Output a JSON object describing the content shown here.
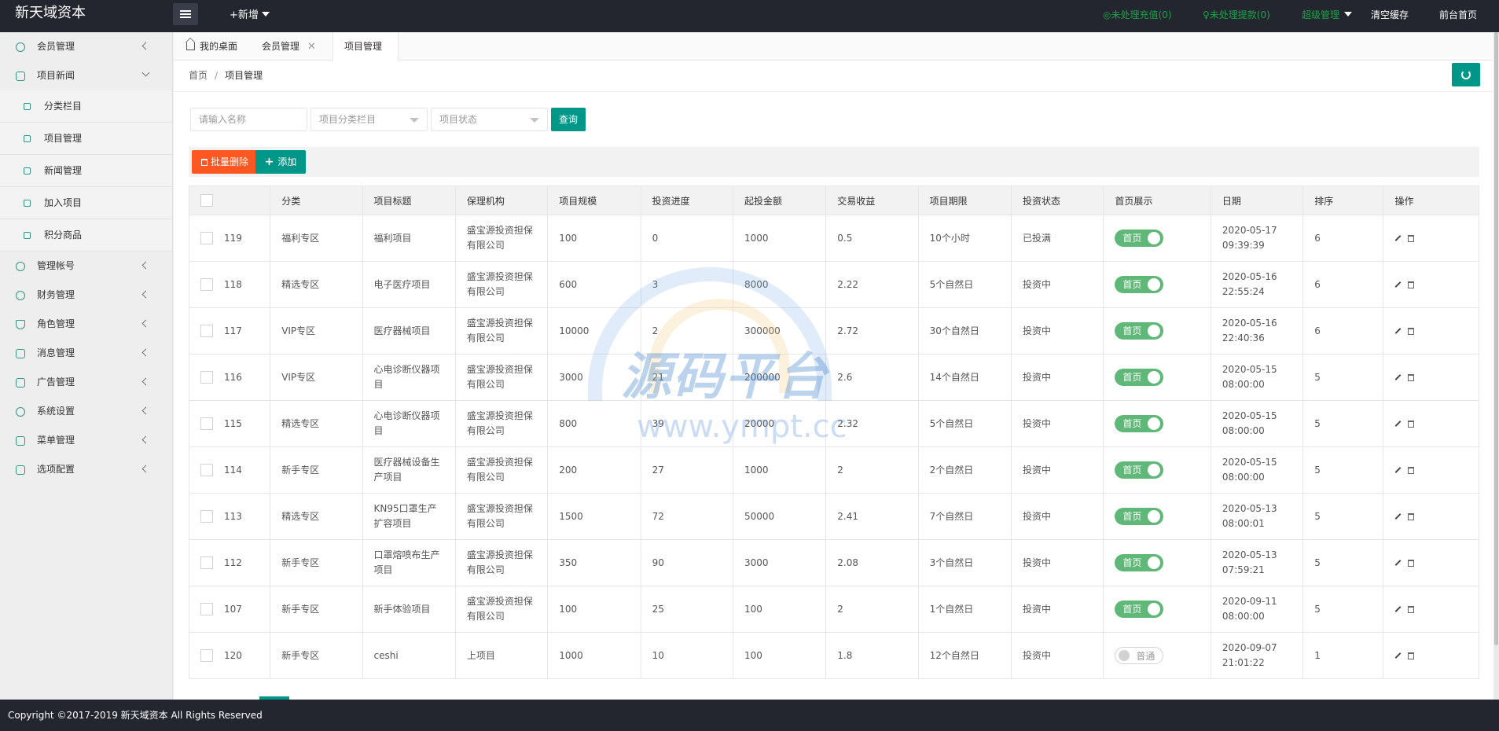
{
  "app": {
    "logo": "新天域资本"
  },
  "topbar": {
    "new_label": "+新增",
    "pending_recharge": "未处理充值(0)",
    "pending_withdraw": "未处理提款(0)",
    "admin_menu": "超级管理",
    "clear_cache": "清空缓存",
    "front_home": "前台首页"
  },
  "sidebar": {
    "items": [
      {
        "label": "会员管理",
        "icon": "user-icon",
        "expanded": false
      },
      {
        "label": "项目新闻",
        "icon": "book-icon",
        "expanded": true
      },
      {
        "label": "管理帐号",
        "icon": "users-icon",
        "expanded": false
      },
      {
        "label": "财务管理",
        "icon": "yen-icon",
        "expanded": false
      },
      {
        "label": "角色管理",
        "icon": "shield-icon",
        "expanded": false
      },
      {
        "label": "消息管理",
        "icon": "speaker-icon",
        "expanded": false
      },
      {
        "label": "广告管理",
        "icon": "image-icon",
        "expanded": false
      },
      {
        "label": "系统设置",
        "icon": "gear-icon",
        "expanded": false
      },
      {
        "label": "菜单管理",
        "icon": "grid-icon",
        "expanded": false
      },
      {
        "label": "选项配置",
        "icon": "tools-icon",
        "expanded": false
      }
    ],
    "subitems": [
      {
        "label": "分类栏目",
        "icon": "leaf-icon"
      },
      {
        "label": "项目管理",
        "icon": "cart-icon"
      },
      {
        "label": "新闻管理",
        "icon": "doc-icon"
      },
      {
        "label": "加入项目",
        "icon": "cart-icon"
      },
      {
        "label": "积分商品",
        "icon": "gift-icon"
      }
    ]
  },
  "tabs": [
    {
      "label": "我的桌面",
      "icon": "home-icon",
      "closable": false
    },
    {
      "label": "会员管理",
      "closable": true
    },
    {
      "label": "项目管理",
      "closable": true,
      "active": true
    }
  ],
  "breadcrumb": {
    "home": "首页",
    "sep": "/",
    "current": "项目管理"
  },
  "search": {
    "name_placeholder": "请输入名称",
    "category_select": "项目分类栏目",
    "status_select": "项目状态",
    "query_label": "查询"
  },
  "toolbar": {
    "batch_delete": "批量删除",
    "add": "添加"
  },
  "table": {
    "headers": [
      "分类",
      "项目标题",
      "保理机构",
      "项目规模",
      "投资进度",
      "起投金额",
      "交易收益",
      "项目期限",
      "投资状态",
      "首页展示",
      "日期",
      "排序",
      "操作"
    ],
    "rows": [
      {
        "id": "119",
        "category": "福利专区",
        "title": "福利项目",
        "agency": "盛宝源投资担保有限公司",
        "scale": "100",
        "progress": "0",
        "min_invest": "1000",
        "yield": "0.5",
        "term": "10个小时",
        "status": "已投满",
        "home": "首页",
        "home_on": true,
        "date": "2020-05-17 09:39:39",
        "sort": "6"
      },
      {
        "id": "118",
        "category": "精选专区",
        "title": "电子医疗项目",
        "agency": "盛宝源投资担保有限公司",
        "scale": "600",
        "progress": "3",
        "min_invest": "8000",
        "yield": "2.22",
        "term": "5个自然日",
        "status": "投资中",
        "home": "首页",
        "home_on": true,
        "date": "2020-05-16 22:55:24",
        "sort": "6"
      },
      {
        "id": "117",
        "category": "VIP专区",
        "title": "医疗器械项目",
        "agency": "盛宝源投资担保有限公司",
        "scale": "10000",
        "progress": "2",
        "min_invest": "300000",
        "yield": "2.72",
        "term": "30个自然日",
        "status": "投资中",
        "home": "首页",
        "home_on": true,
        "date": "2020-05-16 22:40:36",
        "sort": "6"
      },
      {
        "id": "116",
        "category": "VIP专区",
        "title": "心电诊断仪器项目",
        "agency": "盛宝源投资担保有限公司",
        "scale": "3000",
        "progress": "21",
        "min_invest": "200000",
        "yield": "2.6",
        "term": "14个自然日",
        "status": "投资中",
        "home": "首页",
        "home_on": true,
        "date": "2020-05-15 08:00:00",
        "sort": "5"
      },
      {
        "id": "115",
        "category": "精选专区",
        "title": "心电诊断仪器项目",
        "agency": "盛宝源投资担保有限公司",
        "scale": "800",
        "progress": "39",
        "min_invest": "20000",
        "yield": "2.32",
        "term": "5个自然日",
        "status": "投资中",
        "home": "首页",
        "home_on": true,
        "date": "2020-05-15 08:00:00",
        "sort": "5"
      },
      {
        "id": "114",
        "category": "新手专区",
        "title": "医疗器械设备生产项目",
        "agency": "盛宝源投资担保有限公司",
        "scale": "200",
        "progress": "27",
        "min_invest": "1000",
        "yield": "2",
        "term": "2个自然日",
        "status": "投资中",
        "home": "首页",
        "home_on": true,
        "date": "2020-05-15 08:00:00",
        "sort": "5"
      },
      {
        "id": "113",
        "category": "精选专区",
        "title": "KN95口罩生产扩容项目",
        "agency": "盛宝源投资担保有限公司",
        "scale": "1500",
        "progress": "72",
        "min_invest": "50000",
        "yield": "2.41",
        "term": "7个自然日",
        "status": "投资中",
        "home": "首页",
        "home_on": true,
        "date": "2020-05-13 08:00:01",
        "sort": "5"
      },
      {
        "id": "112",
        "category": "新手专区",
        "title": "口罩熔喷布生产项目",
        "agency": "盛宝源投资担保有限公司",
        "scale": "350",
        "progress": "90",
        "min_invest": "3000",
        "yield": "2.08",
        "term": "3个自然日",
        "status": "投资中",
        "home": "首页",
        "home_on": true,
        "date": "2020-05-13 07:59:21",
        "sort": "5"
      },
      {
        "id": "107",
        "category": "新手专区",
        "title": "新手体验项目",
        "agency": "盛宝源投资担保有限公司",
        "scale": "100",
        "progress": "25",
        "min_invest": "100",
        "yield": "2",
        "term": "1个自然日",
        "status": "投资中",
        "home": "首页",
        "home_on": true,
        "date": "2020-09-11 08:00:00",
        "sort": "5"
      },
      {
        "id": "120",
        "category": "新手专区",
        "title": "ceshi",
        "agency": "上项目",
        "scale": "1000",
        "progress": "10",
        "min_invest": "100",
        "yield": "1.8",
        "term": "12个自然日",
        "status": "投资中",
        "home": "普通",
        "home_on": false,
        "date": "2020-09-07 21:01:22",
        "sort": "1"
      }
    ]
  },
  "watermark": {
    "text": "源码平台",
    "url": "www.ympt.cc"
  },
  "footer": {
    "copyright": "Copyright ©2017-2019 新天域资本 All Rights Reserved"
  },
  "colors": {
    "primary": "#009688",
    "danger": "#ff5722",
    "switch_on": "#5fb878",
    "topbar": "#23262e",
    "notice_green": "#1aa34a"
  }
}
